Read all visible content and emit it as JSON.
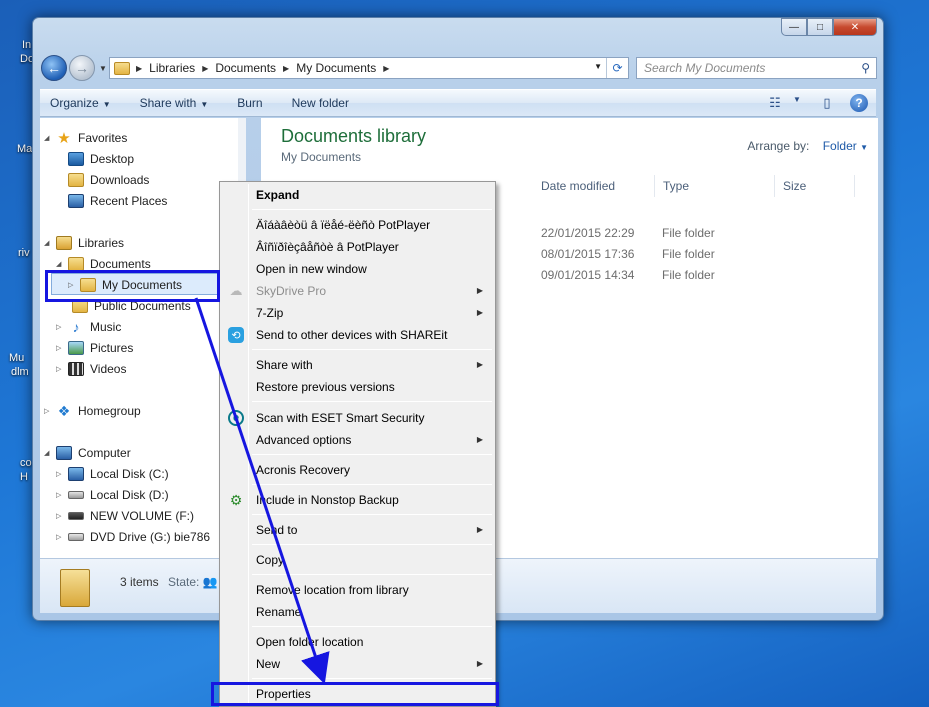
{
  "desktop": {
    "icon_labels": [
      "In",
      "Do",
      "Ma",
      "riv",
      "Mu",
      "dlm",
      "co",
      "H"
    ]
  },
  "window": {
    "controls": {
      "minimize": "—",
      "maximize": "□",
      "close": "✕"
    }
  },
  "nav": {
    "back": "←",
    "forward": "→",
    "breadcrumbs": [
      "Libraries",
      "Documents",
      "My Documents"
    ],
    "search_placeholder": "Search My Documents"
  },
  "toolbar": {
    "organize": "Organize",
    "share_with": "Share with",
    "burn": "Burn",
    "new_folder": "New folder"
  },
  "navpane": {
    "favorites": "Favorites",
    "desktop": "Desktop",
    "downloads": "Downloads",
    "recent_places": "Recent Places",
    "libraries": "Libraries",
    "documents": "Documents",
    "my_documents": "My Documents",
    "public_documents": "Public Documents",
    "music": "Music",
    "pictures": "Pictures",
    "videos": "Videos",
    "homegroup": "Homegroup",
    "computer": "Computer",
    "local_c": "Local Disk (C:)",
    "local_d": "Local Disk (D:)",
    "new_volume": "NEW VOLUME (F:)",
    "dvd": "DVD Drive (G:) bie786"
  },
  "content": {
    "title": "Documents library",
    "subtitle": "My Documents",
    "arrange_label": "Arrange by:",
    "arrange_value": "Folder",
    "columns": [
      "Date modified",
      "Type",
      "Size"
    ],
    "rows": [
      {
        "date": "22/01/2015 22:29",
        "type": "File folder"
      },
      {
        "date": "08/01/2015 17:36",
        "type": "File folder"
      },
      {
        "date": "09/01/2015 14:34",
        "type": "File folder"
      }
    ]
  },
  "status": {
    "count": "3 items",
    "state_label": "State:"
  },
  "context_menu": {
    "expand": "Expand",
    "potplayer_1": "Äîáàâèòü â ïëåé-ëèñò PotPlayer",
    "potplayer_2": "Âîñïðîèçâåñòè â PotPlayer",
    "open_new_window": "Open in new window",
    "skydrive": "SkyDrive Pro",
    "zip": "7-Zip",
    "shareit": "Send to other devices with SHAREit",
    "share_with": "Share with",
    "restore": "Restore previous versions",
    "eset": "Scan with ESET Smart Security",
    "advanced": "Advanced options",
    "acronis": "Acronis Recovery",
    "nonstop": "Include in Nonstop Backup",
    "send_to": "Send to",
    "copy": "Copy",
    "remove_location": "Remove location from library",
    "rename": "Rename",
    "open_folder_location": "Open folder location",
    "new": "New",
    "properties": "Properties"
  },
  "colors": {
    "annotation": "#1616e0",
    "title_green": "#1e6e3a"
  }
}
